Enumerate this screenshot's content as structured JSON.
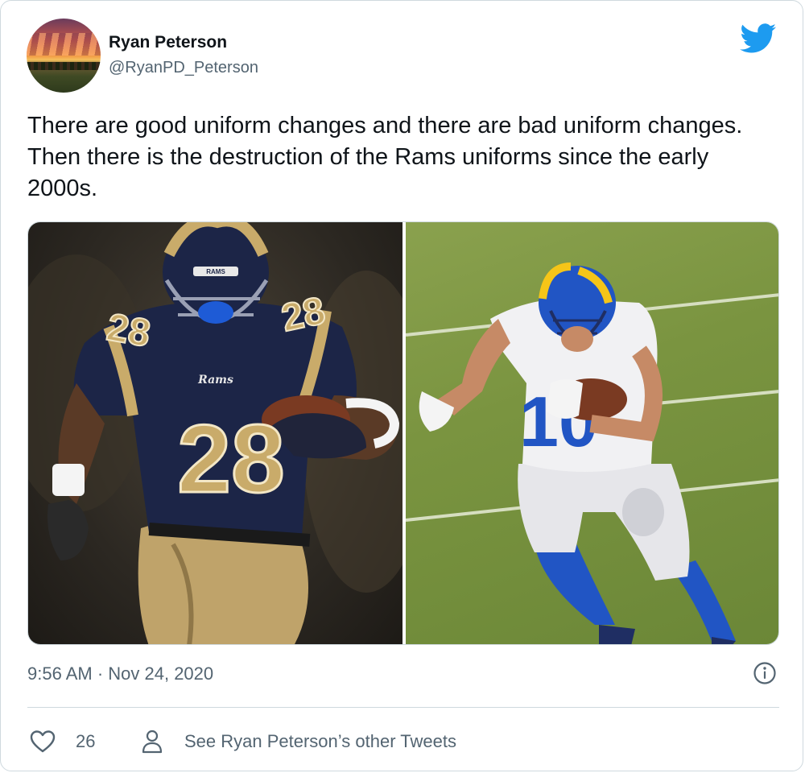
{
  "tweet": {
    "author_name": "Ryan Peterson",
    "author_handle": "@RyanPD_Peterson",
    "text": "There are good uniform changes and there are bad uniform changes. Then there is the destruction of the Rams uniforms since the early 2000s.",
    "timestamp": "9:56 AM · Nov 24, 2020",
    "like_count": "26",
    "other_tweets_label": "See Ryan Peterson’s other Tweets",
    "media": [
      {
        "jersey_number": "28",
        "wordmark": "Rams",
        "helmet_stripe": "RAMS"
      },
      {
        "jersey_number": "10"
      }
    ]
  },
  "colors": {
    "twitter_blue": "#1d9bf0",
    "text_primary": "#0f1419",
    "text_secondary": "#536471",
    "border": "#cfd9de"
  },
  "icons": {
    "logo": "twitter-bird-icon",
    "info": "info-icon",
    "like": "heart-icon",
    "profile": "person-icon"
  }
}
